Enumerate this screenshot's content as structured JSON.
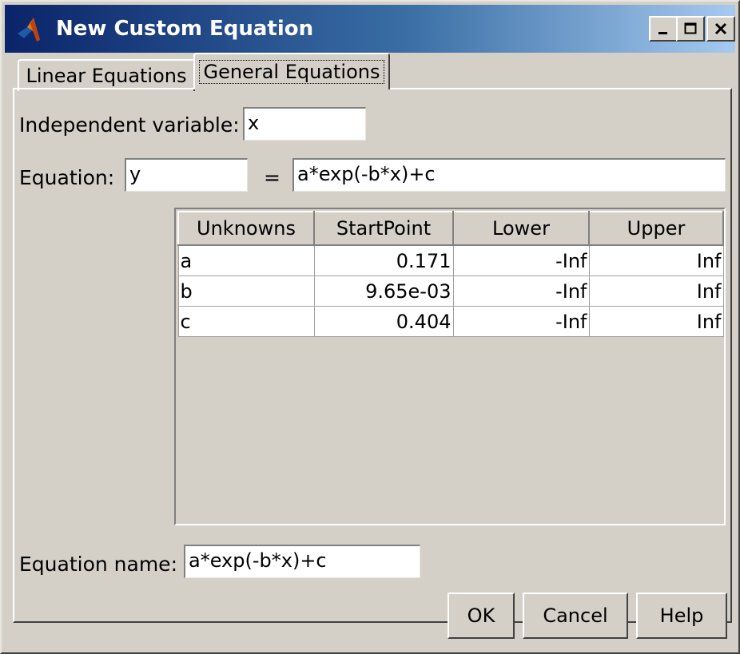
{
  "window": {
    "title": "New Custom Equation"
  },
  "tabs": [
    {
      "label": "Linear Equations"
    },
    {
      "label": "General Equations"
    }
  ],
  "form": {
    "independent_variable_label": "Independent variable:",
    "independent_variable_value": "x",
    "equation_label": "Equation:",
    "dependent_variable_value": "y",
    "equals_sign": "=",
    "equation_value": "a*exp(-b*x)+c",
    "equation_name_label": "Equation name:",
    "equation_name_value": "a*exp(-b*x)+c"
  },
  "table": {
    "headers": [
      "Unknowns",
      "StartPoint",
      "Lower",
      "Upper"
    ],
    "rows": [
      [
        "a",
        "0.171",
        "-Inf",
        "Inf"
      ],
      [
        "b",
        "9.65e-03",
        "-Inf",
        "Inf"
      ],
      [
        "c",
        "0.404",
        "-Inf",
        "Inf"
      ]
    ]
  },
  "buttons": {
    "ok": "OK",
    "cancel": "Cancel",
    "help": "Help"
  },
  "icons": {
    "title": "matlab-logo-icon",
    "minimize": "minimize-icon",
    "maximize": "maximize-icon",
    "close": "close-icon"
  },
  "colors": {
    "titlebar_start": "#0a246a",
    "titlebar_end": "#a6caf0",
    "face": "#d4d0c8"
  }
}
